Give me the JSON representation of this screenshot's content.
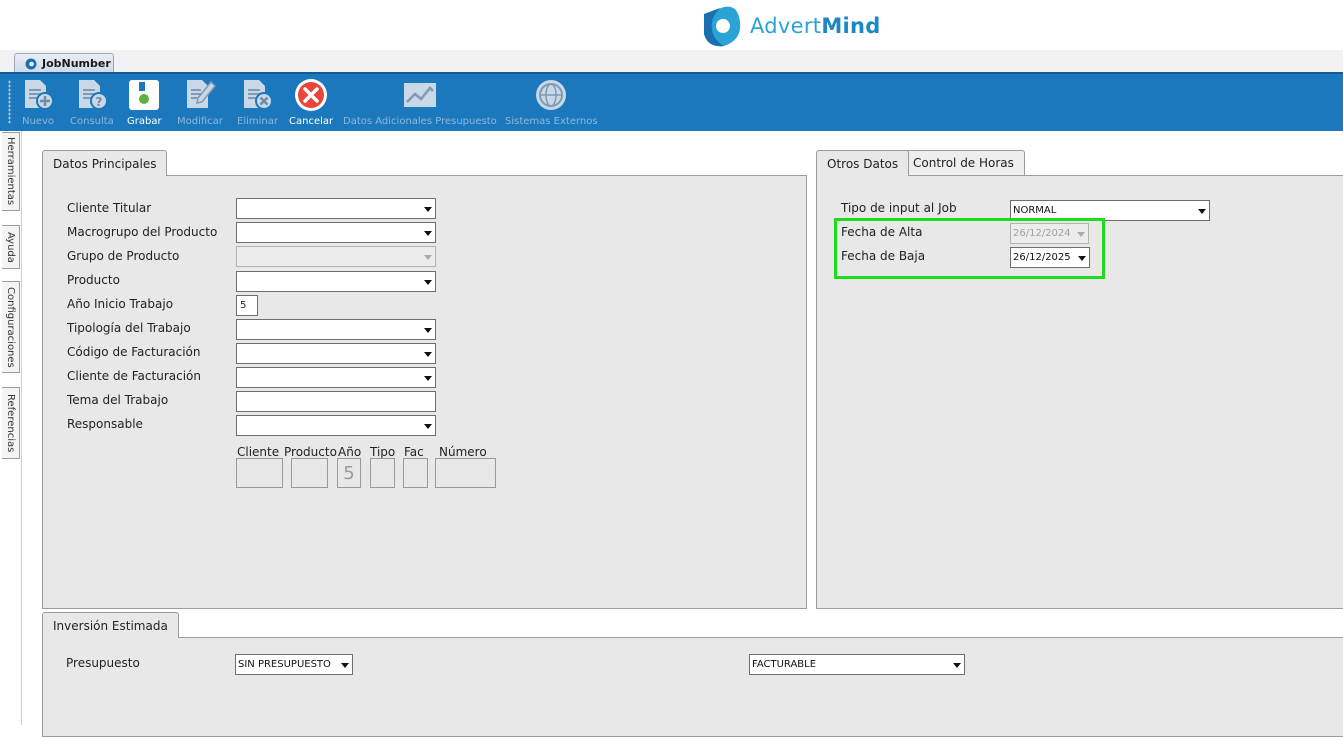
{
  "header": {
    "brand_light": "Advert",
    "brand_bold": "Mind",
    "brand_color": "#2aa3d6"
  },
  "document_tab": {
    "label": "JobNumber"
  },
  "toolbar": {
    "buttons": [
      {
        "label": "Nuevo",
        "icon": "new-document-icon",
        "enabled": false
      },
      {
        "label": "Consulta",
        "icon": "query-document-icon",
        "enabled": false
      },
      {
        "label": "Grabar",
        "icon": "save-icon",
        "enabled": true
      },
      {
        "label": "Modificar",
        "icon": "edit-icon",
        "enabled": false
      },
      {
        "label": "Eliminar",
        "icon": "delete-document-icon",
        "enabled": false
      },
      {
        "label": "Cancelar",
        "icon": "cancel-icon",
        "enabled": true
      },
      {
        "label": "Datos Adicionales Presupuesto",
        "icon": "chart-icon",
        "enabled": false
      },
      {
        "label": "Sistemas Externos",
        "icon": "globe-icon",
        "enabled": false
      }
    ],
    "accent": "#1b78bc"
  },
  "side_tabs": [
    "Herramientas",
    "Ayuda",
    "Configuraciones",
    "Referencias"
  ],
  "datos_principales": {
    "tab": "Datos Principales",
    "fields": {
      "cliente_titular": {
        "label": "Cliente Titular",
        "value": ""
      },
      "macrogrupo": {
        "label": "Macrogrupo del Producto",
        "value": ""
      },
      "grupo": {
        "label": "Grupo de Producto",
        "value": ""
      },
      "producto": {
        "label": "Producto",
        "value": ""
      },
      "anio": {
        "label": "Año Inicio Trabajo",
        "value": "5"
      },
      "tipologia": {
        "label": "Tipología del Trabajo",
        "value": ""
      },
      "codigo_fact": {
        "label": "Código de Facturación",
        "value": ""
      },
      "cliente_fact": {
        "label": "Cliente de Facturación",
        "value": ""
      },
      "tema": {
        "label": "Tema del Trabajo",
        "value": ""
      },
      "responsable": {
        "label": "Responsable",
        "value": ""
      }
    },
    "code": {
      "cliente": {
        "label": "Cliente",
        "value": ""
      },
      "producto": {
        "label": "Producto",
        "value": ""
      },
      "anio": {
        "label": "Año",
        "value": "5"
      },
      "tipo": {
        "label": "Tipo",
        "value": ""
      },
      "fac": {
        "label": "Fac",
        "value": ""
      },
      "numero": {
        "label": "Número",
        "value": ""
      }
    }
  },
  "otros_datos": {
    "tabs": [
      "Otros Datos",
      "Control de Horas"
    ],
    "tipo_input": {
      "label": "Tipo de input al Job",
      "value": "NORMAL"
    },
    "fecha_alta": {
      "label": "Fecha de Alta",
      "value": "26/12/2024"
    },
    "fecha_baja": {
      "label": "Fecha de Baja",
      "value": "26/12/2025"
    },
    "highlight_color": "#1ddc1d"
  },
  "inversion": {
    "tab": "Inversión Estimada",
    "presupuesto": {
      "label": "Presupuesto",
      "value": "SIN PRESUPUESTO"
    },
    "facturable": {
      "value": "FACTURABLE"
    }
  }
}
